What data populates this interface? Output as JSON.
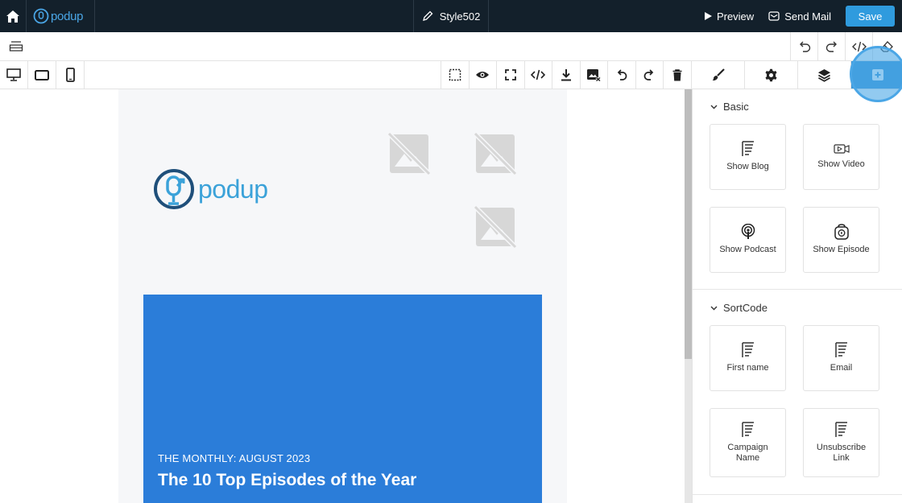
{
  "topbar": {
    "brand_name": "podup",
    "doc_title": "Style502",
    "preview_label": "Preview",
    "send_mail_label": "Send Mail",
    "save_label": "Save"
  },
  "email": {
    "logo_text": "podup",
    "hero_subtitle": "THE MONTHLY: AUGUST 2023",
    "hero_title": "The 10 Top Episodes of the Year"
  },
  "sidebar": {
    "basic_title": "Basic",
    "basic_items": [
      "Show Blog",
      "Show Video",
      "Show Podcast",
      "Show Episode"
    ],
    "sortcode_title": "SortCode",
    "sortcode_items": [
      "First name",
      "Email",
      "Campaign Name",
      "Unsubscribe Link"
    ]
  },
  "colors": {
    "topbar_bg": "#13202b",
    "accent": "#2f9bde",
    "hero_bg": "#2b7dd9",
    "active_tab": "#3b97d8"
  },
  "icons": [
    "home-icon",
    "pencil-icon",
    "play-icon",
    "mail-icon",
    "layers-icon",
    "undo-icon",
    "redo-icon",
    "code-icon",
    "eraser-icon",
    "desktop-icon",
    "tablet-icon",
    "mobile-icon",
    "select-icon",
    "eye-icon",
    "fullscreen-icon",
    "download-icon",
    "image-remove-icon",
    "trash-icon",
    "brush-icon",
    "gear-icon",
    "stack-icon",
    "plus-square-icon"
  ]
}
